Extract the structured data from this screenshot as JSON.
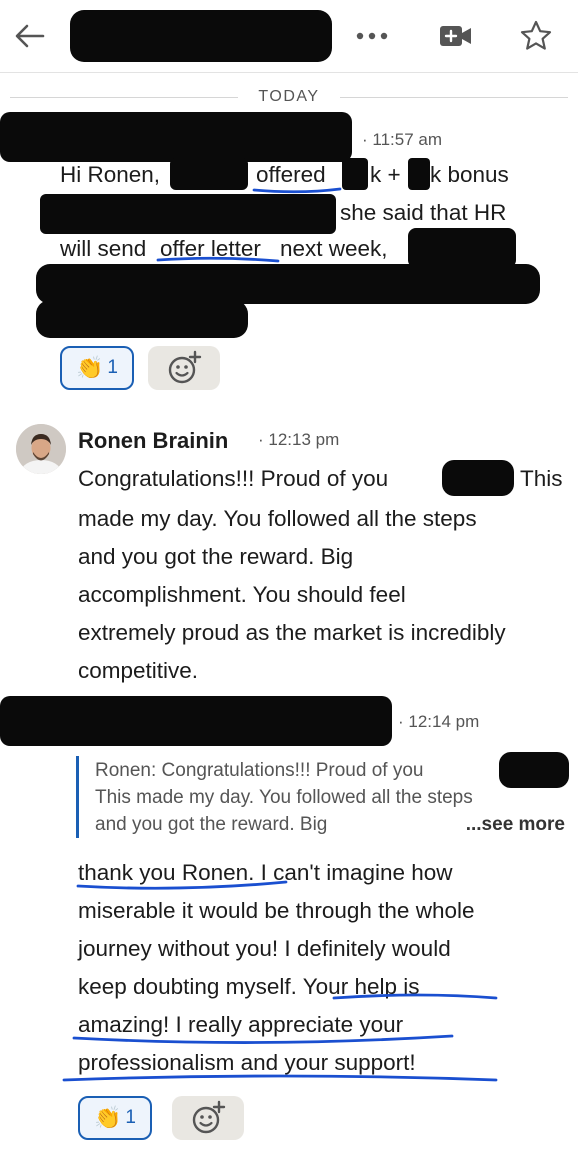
{
  "header": {
    "back_icon": "arrow-left-icon",
    "more_icon": "more-horizontal-icon",
    "video_icon": "video-plus-icon",
    "star_icon": "star-outline-icon"
  },
  "divider": {
    "label": "TODAY"
  },
  "messages": [
    {
      "time": "11:57 am",
      "lines": [
        "Hi Ronen,",
        "offered",
        "k +",
        "k bonus",
        "she said that HR",
        "will send",
        "offer letter",
        "next week,"
      ],
      "reaction": {
        "emoji": "👏",
        "count": "1"
      }
    },
    {
      "sender": "Ronen Brainin",
      "time": "12:13 pm",
      "lines": [
        "Congratulations!!! Proud of you",
        "This",
        "made my day. You followed all the steps",
        "and you got the reward. Big",
        "accomplishment. You should feel",
        "extremely proud as the market is incredibly",
        "competitive."
      ]
    },
    {
      "time": "12:14 pm",
      "quote": {
        "lines": [
          "Ronen: Congratulations!!! Proud of you",
          "This made my day. You followed all the steps",
          "and you got the reward. Big"
        ],
        "see_more": "...see more"
      },
      "lines": [
        "thank you Ronen. I can't imagine how",
        "miserable it would be through the whole",
        "journey without you! I definitely would",
        "keep doubting myself. Your help is",
        "amazing! I really appreciate your",
        "professionalism and your support!"
      ],
      "reaction": {
        "emoji": "👏",
        "count": "1"
      }
    }
  ],
  "colors": {
    "pen": "#1a4fd0",
    "accent": "#1a5fb4",
    "redaction": "#0a0a0a"
  }
}
